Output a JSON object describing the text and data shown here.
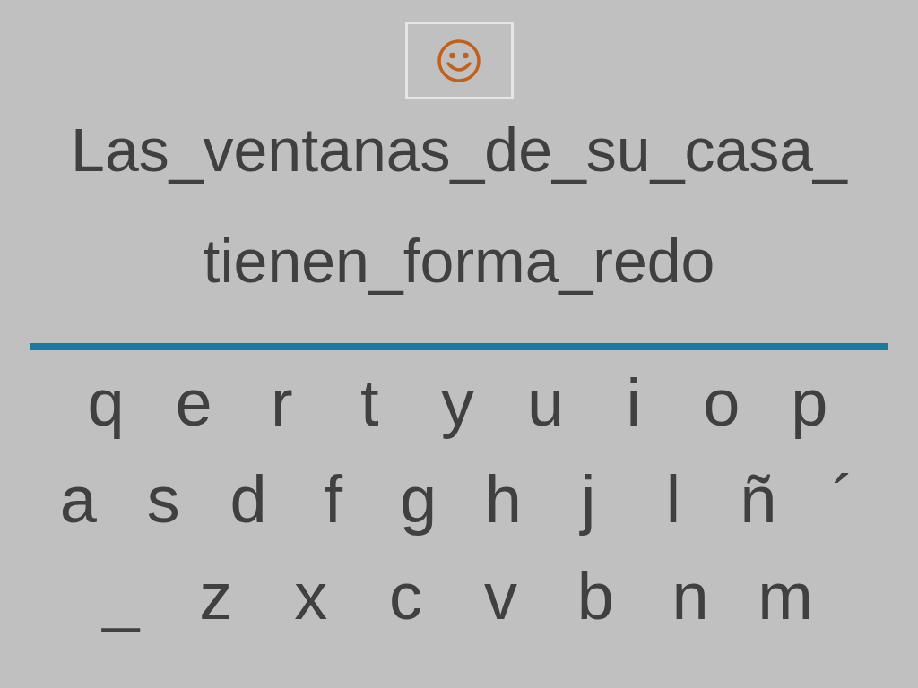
{
  "sentence_lines": [
    "Las_ventanas_de_su_casa_",
    "tienen_forma_redo"
  ],
  "keyboard_rows": [
    [
      "q",
      "e",
      "r",
      "t",
      "y",
      "u",
      "i",
      "o",
      "p"
    ],
    [
      "a",
      "s",
      "d",
      "f",
      "g",
      "h",
      "j",
      "l",
      "ñ",
      "´"
    ],
    [
      "_",
      "z",
      "x",
      "c",
      "v",
      "b",
      "n",
      "m"
    ]
  ]
}
